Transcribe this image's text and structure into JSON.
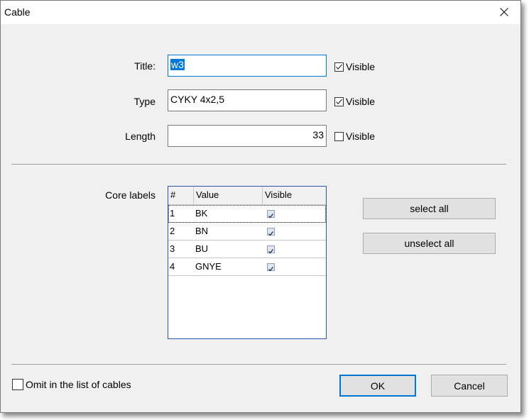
{
  "window": {
    "title": "Cable",
    "close_icon": "close-icon"
  },
  "form": {
    "title": {
      "label": "Title:",
      "value": "w3",
      "visible_label": "Visible",
      "visible_checked": true
    },
    "type": {
      "label": "Type",
      "value": "CYKY 4x2,5",
      "visible_label": "Visible",
      "visible_checked": true
    },
    "length": {
      "label": "Length",
      "value": "33",
      "visible_label": "Visible",
      "visible_checked": false
    }
  },
  "core_labels": {
    "label": "Core labels",
    "columns": [
      "#",
      "Value",
      "Visible"
    ],
    "rows": [
      {
        "num": "1",
        "value": "BK",
        "visible": true
      },
      {
        "num": "2",
        "value": "BN",
        "visible": true
      },
      {
        "num": "3",
        "value": "BU",
        "visible": true
      },
      {
        "num": "4",
        "value": "GNYE",
        "visible": true
      }
    ],
    "select_all_label": "select all",
    "unselect_all_label": "unselect all"
  },
  "footer": {
    "omit_label": "Omit in the list of cables",
    "omit_checked": false,
    "ok_label": "OK",
    "cancel_label": "Cancel"
  },
  "colors": {
    "accent": "#0078d7",
    "grid_border": "#2b55b0",
    "background": "#f0f0f0"
  }
}
